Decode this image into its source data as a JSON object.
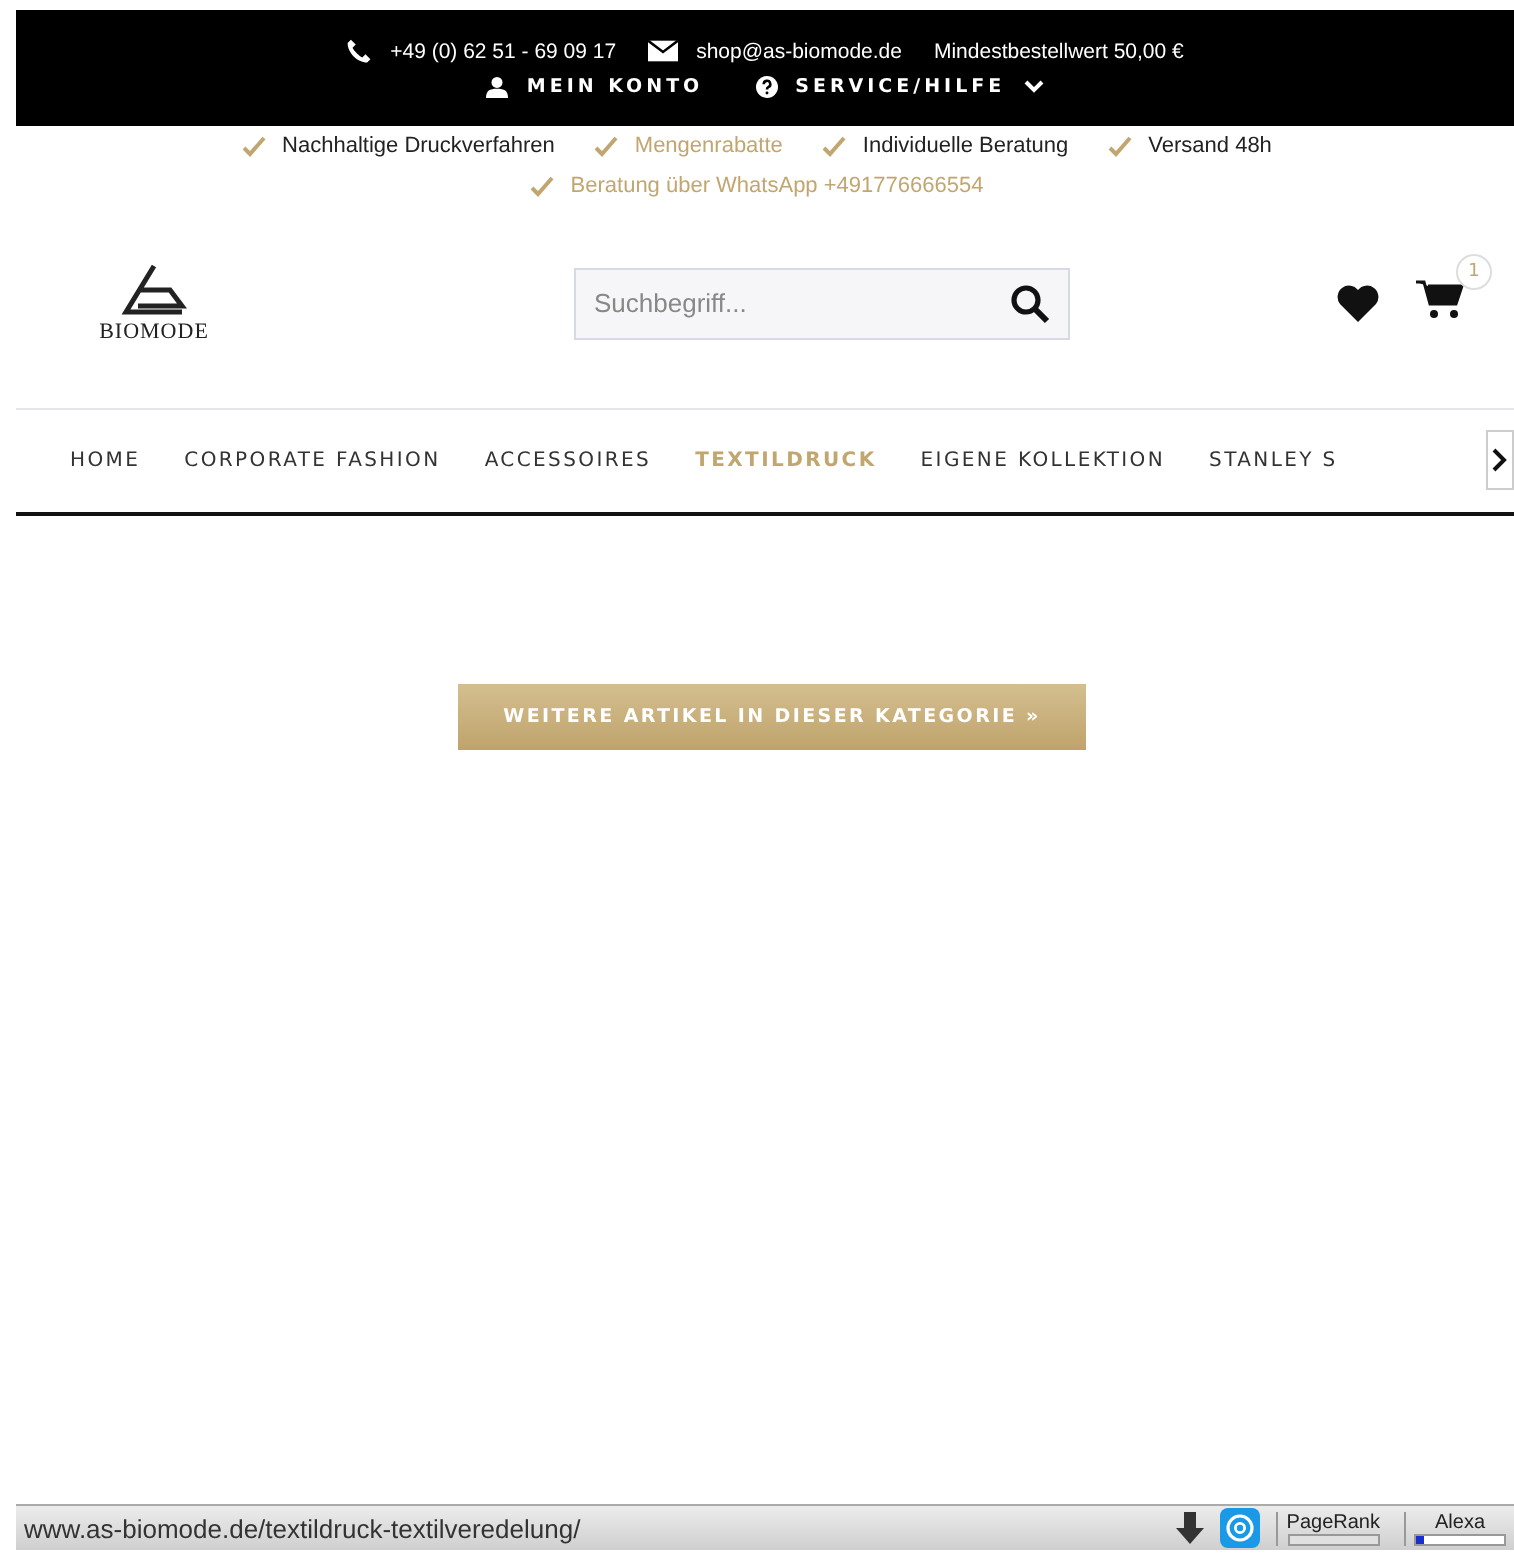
{
  "topbar": {
    "phone": "+49 (0) 62 51 - 69 09 17",
    "email": "shop@as-biomode.de",
    "minimum_order": "Mindestbestellwert 50,00 €",
    "account": "MEIN KONTO",
    "service": "SERVICE/HILFE"
  },
  "usps": [
    {
      "text": "Nachhaltige Druckverfahren",
      "highlighted": false
    },
    {
      "text": "Mengenrabatte",
      "highlighted": true
    },
    {
      "text": "Individuelle Beratung",
      "highlighted": false
    },
    {
      "text": "Versand 48h",
      "highlighted": false
    },
    {
      "text": "Beratung über WhatsApp +491776666554",
      "highlighted": true
    }
  ],
  "logo": {
    "text": "BIOMODE"
  },
  "search": {
    "placeholder": "Suchbegriff..."
  },
  "cart": {
    "count": "1"
  },
  "nav": [
    {
      "label": "HOME",
      "selected": false
    },
    {
      "label": "CORPORATE FASHION",
      "selected": false
    },
    {
      "label": "ACCESSOIRES",
      "selected": false
    },
    {
      "label": "TEXTILDRUCK",
      "selected": true
    },
    {
      "label": "EIGENE KOLLEKTION",
      "selected": false
    },
    {
      "label": "STANLEY S",
      "selected": false
    }
  ],
  "more_button": "WEITERE ARTIKEL IN DIESER KATEGORIE »",
  "status_bar": {
    "url": "www.as-biomode.de/textildruck-textilveredelung/",
    "pagerank": "PageRank",
    "alexa": "Alexa"
  }
}
